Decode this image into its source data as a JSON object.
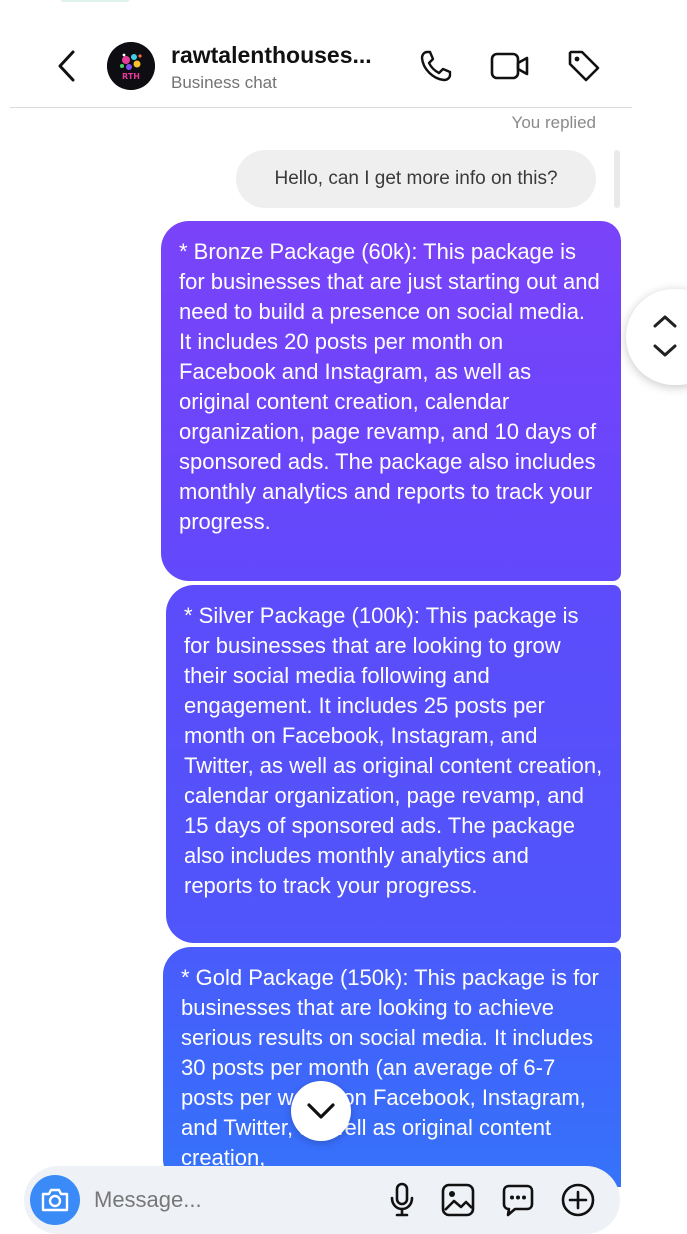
{
  "header": {
    "name": "rawtalenthouses...",
    "subtitle": "Business chat",
    "avatar_initials": "RTH"
  },
  "messages": {
    "replied_label": "You replied",
    "quoted_text": "Hello, can I get more info on this?",
    "bubbles": [
      "* Bronze Package (60k): This package is for businesses that are just starting out and need to build a presence on social media. It includes 20 posts per month on Facebook and Instagram, as well as original content creation, calendar organization, page revamp, and 10 days of sponsored ads. The package also includes monthly analytics and reports to track your progress.",
      "* Silver Package (100k): This package is for businesses that are looking to grow their social media following and engagement. It includes 25 posts per month on Facebook, Instagram, and Twitter, as well as original content creation, calendar organization, page revamp, and 15 days of sponsored ads. The package also includes monthly analytics and reports to track your progress.",
      "* Gold Package (150k): This package is for businesses that are looking to achieve serious results on social media. It includes 30 posts per month (an average of 6-7 posts per week) on Facebook, Instagram, and Twitter, as well as original content creation,"
    ]
  },
  "composer": {
    "placeholder": "Message..."
  },
  "icons": {
    "back": "chevron-left-icon",
    "call": "phone-icon",
    "video": "video-camera-icon",
    "tag": "tag-icon",
    "scroll_up": "chevron-up-icon",
    "scroll_down": "chevron-down-icon",
    "jump": "chevron-down-icon",
    "camera": "camera-icon",
    "mic": "microphone-icon",
    "gallery": "image-icon",
    "sticker": "chat-dots-icon",
    "plus": "plus-circle-icon"
  },
  "colors": {
    "accent_blue": "#3a8af7",
    "bubble_top": "#7a43f9",
    "bubble_bottom": "#3573fa"
  }
}
